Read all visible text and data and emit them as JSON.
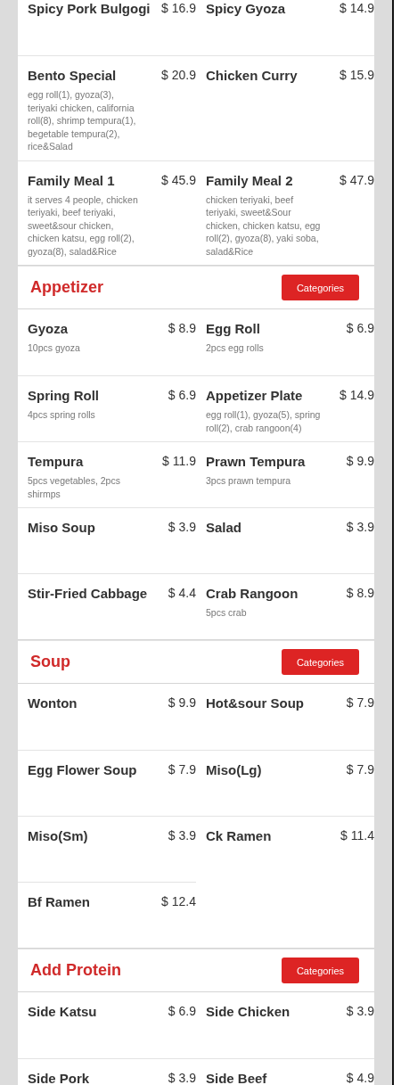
{
  "sections": [
    {
      "items": [
        {
          "name": "Spicy Pork Bulgogi",
          "price": "$ 16.9"
        },
        {
          "name": "Spicy Gyoza",
          "price": "$ 14.9"
        },
        {
          "name": "Bento Special",
          "price": "$ 20.9",
          "description": "egg roll(1), gyoza(3), teriyaki chicken, california roll(8), shrimp tempura(1), begetable tempura(2), rice&Salad"
        },
        {
          "name": "Chicken Curry",
          "price": "$ 15.9"
        },
        {
          "name": "Family Meal 1",
          "price": "$ 45.9",
          "description": "it serves 4 people, chicken teriyaki, beef teriyaki, sweet&sour chicken, chicken katsu, egg roll(2), gyoza(8), salad&Rice"
        },
        {
          "name": "Family Meal 2",
          "price": "$ 47.9",
          "description": "chicken teriyaki, beef teriyaki, sweet&Sour chicken, chicken katsu, egg roll(2), gyoza(8), yaki soba, salad&Rice"
        }
      ]
    },
    {
      "title": "Appetizer",
      "button": "Categories",
      "items": [
        {
          "name": "Gyoza",
          "price": "$ 8.9",
          "description": "10pcs gyoza"
        },
        {
          "name": "Egg Roll",
          "price": "$ 6.9",
          "description": "2pcs egg rolls"
        },
        {
          "name": "Spring Roll",
          "price": "$ 6.9",
          "description": "4pcs spring rolls"
        },
        {
          "name": "Appetizer Plate",
          "price": "$ 14.9",
          "description": "egg roll(1), gyoza(5), spring roll(2), crab rangoon(4)"
        },
        {
          "name": "Tempura",
          "price": "$ 11.9",
          "description": "5pcs vegetables, 2pcs shirmps"
        },
        {
          "name": "Prawn Tempura",
          "price": "$ 9.9",
          "description": "3pcs prawn tempura"
        },
        {
          "name": "Miso Soup",
          "price": "$ 3.9"
        },
        {
          "name": "Salad",
          "price": "$ 3.9"
        },
        {
          "name": "Stir-Fried Cabbage",
          "price": "$ 4.4"
        },
        {
          "name": "Crab Rangoon",
          "price": "$ 8.9",
          "description": "5pcs crab"
        }
      ]
    },
    {
      "title": "Soup",
      "button": "Categories",
      "items": [
        {
          "name": "Wonton",
          "price": "$ 9.9"
        },
        {
          "name": "Hot&sour Soup",
          "price": "$ 7.9"
        },
        {
          "name": "Egg Flower Soup",
          "price": "$ 7.9"
        },
        {
          "name": "Miso(Lg)",
          "price": "$ 7.9"
        },
        {
          "name": "Miso(Sm)",
          "price": "$ 3.9"
        },
        {
          "name": "Ck Ramen",
          "price": "$ 11.4"
        },
        {
          "name": "Bf Ramen",
          "price": "$ 12.4"
        }
      ]
    },
    {
      "title": "Add Protein",
      "button": "Categories",
      "items": [
        {
          "name": "Side Katsu",
          "price": "$ 6.9"
        },
        {
          "name": "Side Chicken",
          "price": "$ 3.9"
        },
        {
          "name": "Side Pork",
          "price": "$ 3.9"
        },
        {
          "name": "Side Beef",
          "price": "$ 4.9"
        }
      ]
    }
  ]
}
